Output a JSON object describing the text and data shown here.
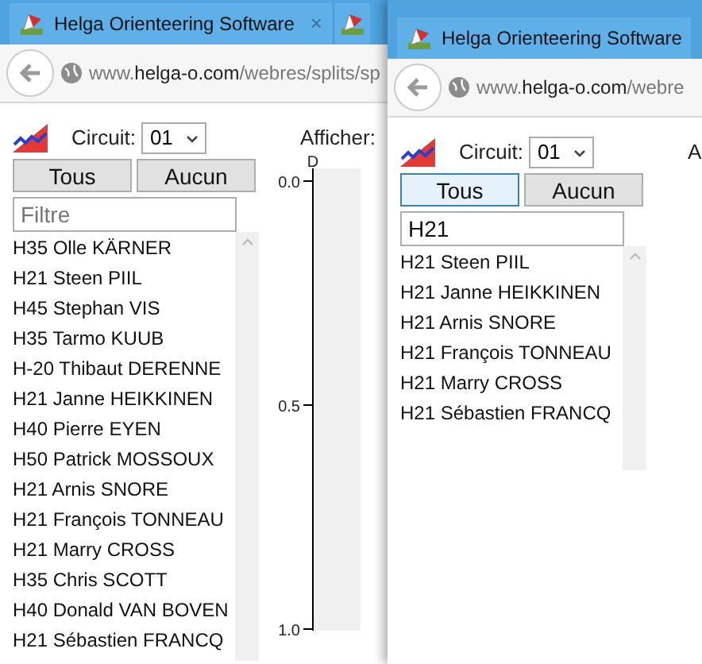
{
  "windows": [
    {
      "tab": {
        "title": "Helga Orienteering Software",
        "close": "×"
      },
      "next_tab_visible": true,
      "address": {
        "prefix": "www.",
        "domain": "helga-o.com",
        "path": "/webres/splits/sp"
      },
      "circuit_label": "Circuit:",
      "circuit_value": "01",
      "display_label": "Afficher:",
      "buttons": [
        {
          "label": "Tous",
          "selected": false
        },
        {
          "label": "Aucun",
          "selected": false
        }
      ],
      "filter": {
        "placeholder": "Filtre"
      },
      "runners": [
        "H35 Olle KÄRNER",
        "H21 Steen PIIL",
        "H45 Stephan VIS",
        "H35 Tarmo KUUB",
        "H-20 Thibaut DERENNE",
        "H21 Janne HEIKKINEN",
        "H40 Pierre EYEN",
        "H50 Patrick MOSSOUX",
        "H21 Arnis SNORE",
        "H21 François TONNEAU",
        "H21 Marry CROSS",
        "H35 Chris SCOTT",
        "H40 Donald VAN BOVEN",
        "H21 Sébastien FRANCQ"
      ],
      "axis": {
        "top_label": "D",
        "ticks": [
          "0.0",
          "0.5",
          "1.0"
        ]
      }
    },
    {
      "tab": {
        "title": "Helga Orienteering Software"
      },
      "next_tab_visible": false,
      "address": {
        "prefix": "www.",
        "domain": "helga-o.com",
        "path": "/webre"
      },
      "circuit_label": "Circuit:",
      "circuit_value": "01",
      "display_label": "A",
      "buttons": [
        {
          "label": "Tous",
          "selected": true
        },
        {
          "label": "Aucun",
          "selected": false
        }
      ],
      "filter": {
        "value": "H21"
      },
      "runners": [
        "H21 Steen PIIL",
        "H21 Janne HEIKKINEN",
        "H21 Arnis SNORE",
        "H21 François TONNEAU",
        "H21 Marry CROSS",
        "H21 Sébastien FRANCQ"
      ]
    }
  ]
}
